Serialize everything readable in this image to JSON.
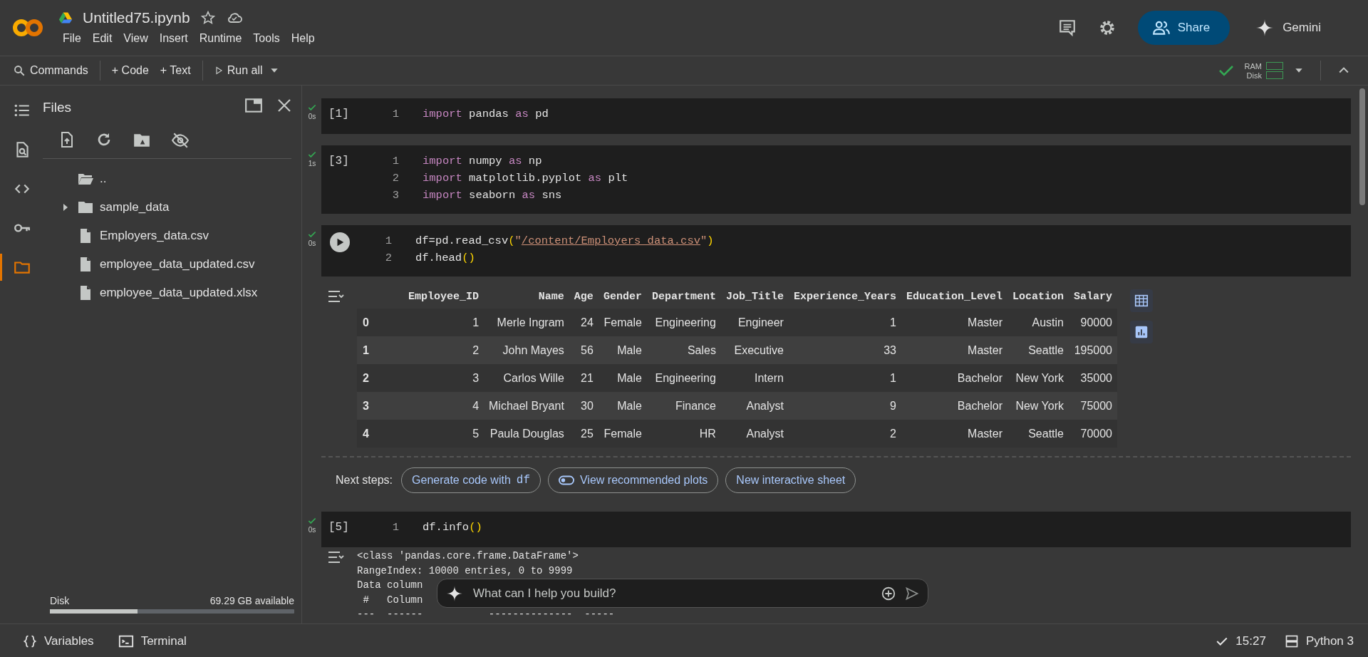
{
  "header": {
    "title": "Untitled75.ipynb",
    "menu": [
      "File",
      "Edit",
      "View",
      "Insert",
      "Runtime",
      "Tools",
      "Help"
    ],
    "share": "Share",
    "gemini": "Gemini"
  },
  "toolbar": {
    "commands": "Commands",
    "add_code": "+ Code",
    "add_text": "+ Text",
    "run_all": "Run all",
    "ram": "RAM",
    "disk": "Disk",
    "connected": true
  },
  "rail": [
    {
      "selected": false
    },
    {
      "selected": false
    },
    {
      "selected": false
    },
    {
      "selected": false
    },
    {
      "selected": true
    }
  ],
  "files": {
    "title": "Files",
    "tree": [
      {
        "kind": "parent",
        "name": ".."
      },
      {
        "kind": "folder",
        "name": "sample_data",
        "expanded": false
      },
      {
        "kind": "file",
        "name": "Employers_data.csv"
      },
      {
        "kind": "file",
        "name": "employee_data_updated.csv"
      },
      {
        "kind": "file",
        "name": "employee_data_updated.xlsx"
      }
    ],
    "disk": {
      "label": "Disk",
      "available": "69.29 GB available",
      "level": 0.36
    }
  },
  "cells": [
    {
      "succeeded": true,
      "time": "0s",
      "hovered": false,
      "execution_count": "[1]",
      "lines": [
        {
          "number": "1",
          "tokens": [
            {
              "kind": "kw",
              "text": "import"
            },
            {
              "kind": "plain",
              "text": " pandas "
            },
            {
              "kind": "kw",
              "text": "as"
            },
            {
              "kind": "plain",
              "text": " pd"
            }
          ]
        }
      ]
    },
    {
      "succeeded": true,
      "time": "1s",
      "hovered": false,
      "execution_count": "[3]",
      "lines": [
        {
          "number": "1",
          "tokens": [
            {
              "kind": "kw",
              "text": "import"
            },
            {
              "kind": "plain",
              "text": " numpy "
            },
            {
              "kind": "kw",
              "text": "as"
            },
            {
              "kind": "plain",
              "text": " np"
            }
          ]
        },
        {
          "number": "2",
          "tokens": [
            {
              "kind": "kw",
              "text": "import"
            },
            {
              "kind": "plain",
              "text": " matplotlib.pyplot "
            },
            {
              "kind": "kw",
              "text": "as"
            },
            {
              "kind": "plain",
              "text": " plt"
            }
          ]
        },
        {
          "number": "3",
          "tokens": [
            {
              "kind": "kw",
              "text": "import"
            },
            {
              "kind": "plain",
              "text": " seaborn "
            },
            {
              "kind": "kw",
              "text": "as"
            },
            {
              "kind": "plain",
              "text": " sns"
            }
          ]
        }
      ]
    },
    {
      "succeeded": true,
      "time": "0s",
      "hovered": true,
      "lines": [
        {
          "number": "1",
          "tokens": [
            {
              "kind": "plain",
              "text": "df=pd.read_csv"
            },
            {
              "kind": "paren",
              "text": "("
            },
            {
              "kind": "str",
              "text": "\""
            },
            {
              "kind": "path",
              "text": "/content/Employers_data.csv"
            },
            {
              "kind": "str",
              "text": "\""
            },
            {
              "kind": "paren",
              "text": ")"
            }
          ]
        },
        {
          "number": "2",
          "tokens": [
            {
              "kind": "plain",
              "text": "df.head"
            },
            {
              "kind": "paren",
              "text": "()"
            }
          ]
        }
      ],
      "output": {
        "kind": "table",
        "columns": [
          "",
          "Employee_ID",
          "Name",
          "Age",
          "Gender",
          "Department",
          "Job_Title",
          "Experience_Years",
          "Education_Level",
          "Location",
          "Salary"
        ],
        "rows": [
          [
            "0",
            "1",
            "Merle Ingram",
            "24",
            "Female",
            "Engineering",
            "Engineer",
            "1",
            "Master",
            "Austin",
            "90000"
          ],
          [
            "1",
            "2",
            "John Mayes",
            "56",
            "Male",
            "Sales",
            "Executive",
            "33",
            "Master",
            "Seattle",
            "195000"
          ],
          [
            "2",
            "3",
            "Carlos Wille",
            "21",
            "Male",
            "Engineering",
            "Intern",
            "1",
            "Bachelor",
            "New York",
            "35000"
          ],
          [
            "3",
            "4",
            "Michael Bryant",
            "30",
            "Male",
            "Finance",
            "Analyst",
            "9",
            "Bachelor",
            "New York",
            "75000"
          ],
          [
            "4",
            "5",
            "Paula Douglas",
            "25",
            "Female",
            "HR",
            "Analyst",
            "2",
            "Master",
            "Seattle",
            "70000"
          ]
        ],
        "next_steps": {
          "label": "Next steps:",
          "chips": [
            {
              "kind": "code",
              "text": "Generate code with",
              "code": "df"
            },
            {
              "kind": "toggle",
              "text": "View recommended plots"
            },
            {
              "kind": "plain",
              "text": "New interactive sheet"
            }
          ]
        }
      }
    },
    {
      "succeeded": true,
      "time": "0s",
      "hovered": false,
      "execution_count": "[5]",
      "lines": [
        {
          "number": "1",
          "tokens": [
            {
              "kind": "plain",
              "text": "df.info"
            },
            {
              "kind": "paren",
              "text": "()"
            }
          ]
        }
      ],
      "output": {
        "kind": "text",
        "lines": [
          "<class 'pandas.core.frame.DataFrame'>",
          "RangeIndex: 10000 entries, 0 to 9999",
          "Data column",
          " #   Column",
          "---  ------           --------------  -----"
        ]
      }
    }
  ],
  "prompt": {
    "placeholder": "What can I help you build?"
  },
  "status_bar": {
    "variables": "Variables",
    "terminal": "Terminal",
    "time": "15:27",
    "connected": true,
    "runtime": "Python 3"
  }
}
